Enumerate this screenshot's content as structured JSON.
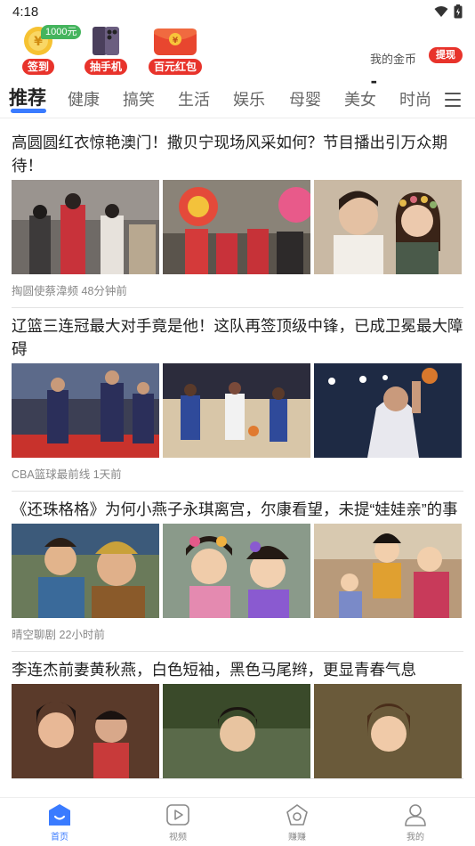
{
  "status_bar": {
    "time": "4:18"
  },
  "promo": {
    "checkin": {
      "label": "签到",
      "badge": "1000元"
    },
    "phone": {
      "label": "抽手机"
    },
    "redpacket": {
      "label": "百元红包"
    }
  },
  "gold": {
    "title": "我的金币",
    "withdraw_label": "提现",
    "value": "-"
  },
  "tabs": [
    {
      "label": "推荐",
      "active": true
    },
    {
      "label": "健康"
    },
    {
      "label": "搞笑"
    },
    {
      "label": "生活"
    },
    {
      "label": "娱乐"
    },
    {
      "label": "母婴"
    },
    {
      "label": "美女"
    },
    {
      "label": "时尚"
    }
  ],
  "articles": [
    {
      "title": "高圆圆红衣惊艳澳门！撒贝宁现场风采如何？节目播出引万众期待！",
      "source": "掏圆使蔡湋频",
      "time": "48分钟前"
    },
    {
      "title": "辽篮三连冠最大对手竟是他！这队再签顶级中锋，已成卫冕最大障碍",
      "source": "CBA篮球最前线",
      "time": "1天前"
    },
    {
      "title": "《还珠格格》为何小燕子永琪离宫，尔康看望，未提“娃娃亲”的事",
      "source": "晴空聊剧",
      "time": "22小时前"
    },
    {
      "title": "李连杰前妻黄秋燕，白色短袖，黑色马尾辫，更显青春气息",
      "source": "",
      "time": ""
    }
  ],
  "bottom_nav": [
    {
      "label": "首页",
      "icon": "home-icon",
      "active": true
    },
    {
      "label": "视频",
      "icon": "video-icon"
    },
    {
      "label": "赚赚",
      "icon": "earn-icon"
    },
    {
      "label": "我的",
      "icon": "profile-icon"
    }
  ],
  "colors": {
    "accent": "#3a7bff",
    "brand_red": "#e8332b",
    "badge_green": "#44b45d"
  }
}
